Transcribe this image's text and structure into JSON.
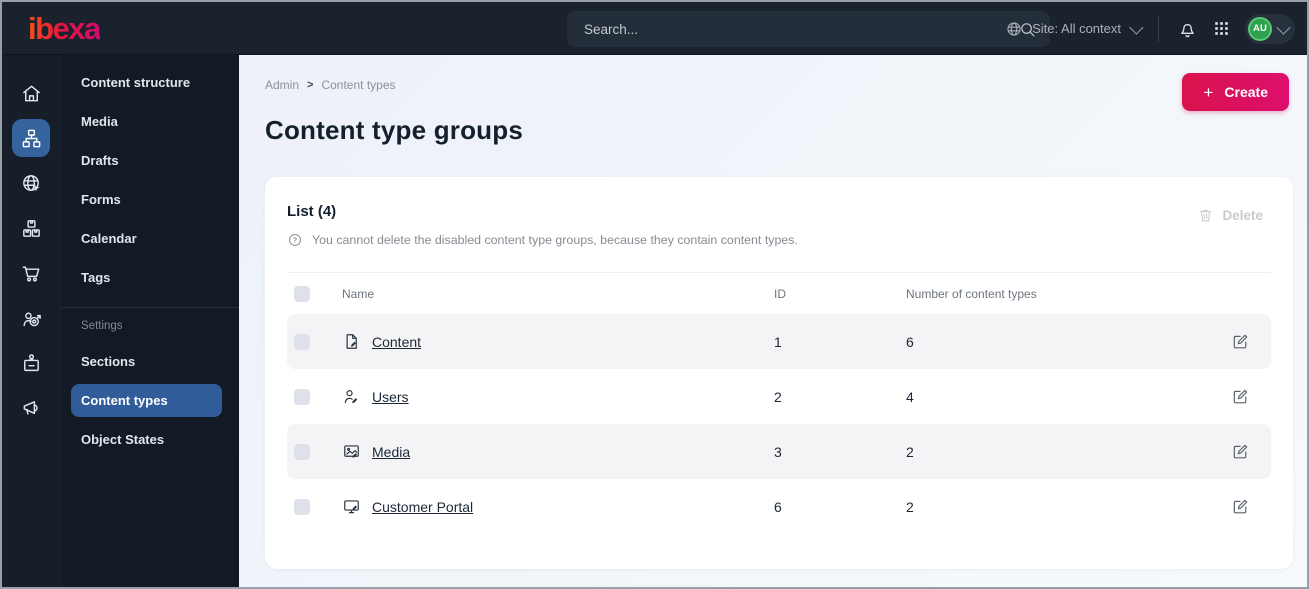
{
  "topbar": {
    "logo": "ibexa",
    "search_placeholder": "Search...",
    "site_selector": "Site: All context",
    "avatar_initials": "AU"
  },
  "icon_rail": {
    "items": [
      "home-icon",
      "content-tree-icon",
      "site-globe-icon",
      "product-catalog-icon",
      "commerce-cart-icon",
      "personalization-target-icon",
      "admin-badge-icon",
      "marketing-megaphone-icon"
    ],
    "active_index": 1
  },
  "sidebar": {
    "items": [
      "Content structure",
      "Media",
      "Drafts",
      "Forms",
      "Calendar",
      "Tags"
    ],
    "section_label": "Settings",
    "settings_items": [
      "Sections",
      "Content types",
      "Object States"
    ],
    "active_item": "Content types"
  },
  "main": {
    "breadcrumb": [
      "Admin",
      "Content types"
    ],
    "breadcrumb_separator": ">",
    "create_plus": "+",
    "create_label": "Create",
    "page_title": "Content type groups",
    "list": {
      "title": "List (4)",
      "help_text": "You cannot delete the disabled content type groups, because they contain content types.",
      "delete_label": "Delete",
      "table": {
        "columns": [
          "Name",
          "ID",
          "Number of content types"
        ],
        "rows": [
          {
            "name": "Content",
            "id": "1",
            "count": "6",
            "icon": "file-edit-icon"
          },
          {
            "name": "Users",
            "id": "2",
            "count": "4",
            "icon": "user-edit-icon"
          },
          {
            "name": "Media",
            "id": "3",
            "count": "2",
            "icon": "image-edit-icon"
          },
          {
            "name": "Customer Portal",
            "id": "6",
            "count": "2",
            "icon": "monitor-edit-icon"
          }
        ]
      }
    }
  },
  "colors": {
    "brand-start": "#ff4e12",
    "brand-mid": "#e31345",
    "brand-end": "#cf0e6d",
    "accent-blue": "#35639e",
    "create-start": "#d9134b",
    "create-end": "#dc0f6e",
    "avatar-green": "#2fa14e"
  }
}
